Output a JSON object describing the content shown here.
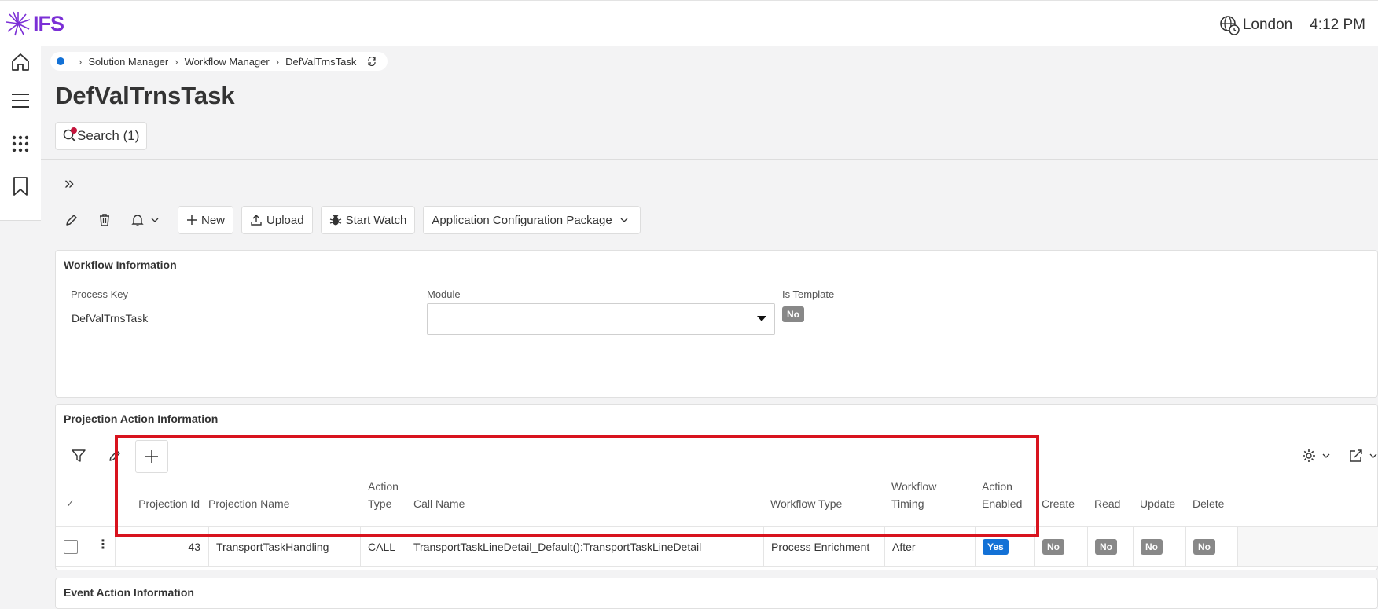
{
  "app": {
    "logo_text": "IFS"
  },
  "header": {
    "location": "London",
    "time": "4:12 PM"
  },
  "nav": {
    "items": [
      "home-icon",
      "menu-icon",
      "apps-grid-icon",
      "bookmark-icon"
    ]
  },
  "breadcrumb": {
    "items": [
      "Solution Manager",
      "Workflow Manager",
      "DefValTrnsTask"
    ]
  },
  "page": {
    "title": "DefValTrnsTask",
    "search_label": "Search (1)"
  },
  "toolbar": {
    "new_label": "New",
    "upload_label": "Upload",
    "start_watch_label": "Start Watch",
    "config_package_label": "Application Configuration Package"
  },
  "workflow_info": {
    "title": "Workflow Information",
    "process_key_label": "Process Key",
    "process_key_value": "DefValTrnsTask",
    "module_label": "Module",
    "module_value": "",
    "is_template_label": "Is Template",
    "is_template_value": "No"
  },
  "projection_action": {
    "title": "Projection Action Information",
    "columns": {
      "projection_id": "Projection Id",
      "projection_name": "Projection Name",
      "action_type_1": "Action",
      "action_type_2": "Type",
      "call_name": "Call Name",
      "workflow_type": "Workflow Type",
      "workflow_timing_1": "Workflow",
      "workflow_timing_2": "Timing",
      "action_enabled_1": "Action",
      "action_enabled_2": "Enabled",
      "create": "Create",
      "read": "Read",
      "update": "Update",
      "delete": "Delete"
    },
    "rows": [
      {
        "projection_id": "43",
        "projection_name": "TransportTaskHandling",
        "action_type": "CALL",
        "call_name": "TransportTaskLineDetail_Default():TransportTaskLineDetail",
        "workflow_type": "Process Enrichment",
        "workflow_timing": "After",
        "action_enabled": "Yes",
        "create": "No",
        "read": "No",
        "update": "No",
        "delete": "No"
      }
    ]
  },
  "event_action": {
    "title": "Event Action Information"
  },
  "colors": {
    "brand": "#7b2fd6",
    "accent": "#1371d6",
    "highlight": "#d8131e",
    "badge_gray": "#888888"
  }
}
